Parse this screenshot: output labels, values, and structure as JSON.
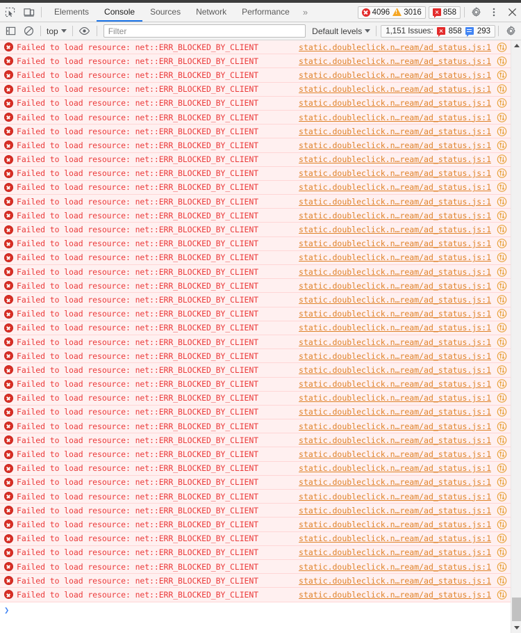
{
  "tabbar": {
    "inspect_icon": "inspect-element-icon",
    "device_icon": "device-toolbar-icon",
    "tabs": [
      {
        "label": "Elements",
        "active": false
      },
      {
        "label": "Console",
        "active": true
      },
      {
        "label": "Sources",
        "active": false
      },
      {
        "label": "Network",
        "active": false
      },
      {
        "label": "Performance",
        "active": false
      }
    ],
    "more_tabs_label": "»",
    "counters": {
      "errors": "4096",
      "warnings": "3016",
      "issues": "858"
    },
    "settings_icon": "gear-icon",
    "more_icon": "vertical-dots-icon",
    "close_icon": "close-icon"
  },
  "filterbar": {
    "sidebar_toggle_icon": "console-sidebar-icon",
    "clear_icon": "clear-console-icon",
    "context": "top",
    "eye_icon": "live-expression-icon",
    "filter_placeholder": "Filter",
    "filter_value": "",
    "levels_label": "Default levels",
    "issues_label": "1,151 Issues:",
    "issues_error_count": "858",
    "issues_info_count": "293",
    "settings_icon": "console-settings-gear-icon"
  },
  "console": {
    "message_text": "Failed to load resource: net::ERR_BLOCKED_BY_CLIENT",
    "source_link": "static.doubleclick.n…ream/ad_status.js:1",
    "network_icon": "network-request-icon",
    "message_count": 40,
    "prompt_caret": "❯"
  },
  "colors": {
    "error_red": "#eb3b3b",
    "error_row_bg": "#fff0f0",
    "source_orange": "#e0832b",
    "accent_blue": "#1a73e8",
    "toolbar_bg": "#f3f3f3"
  }
}
